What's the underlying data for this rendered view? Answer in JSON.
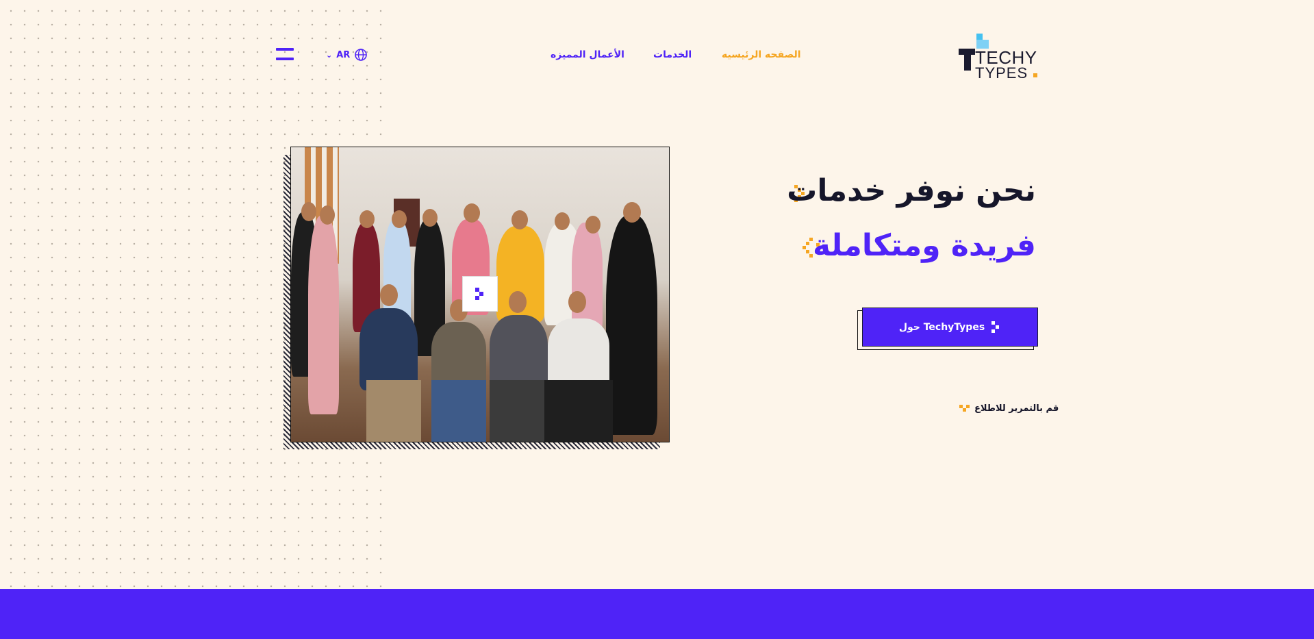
{
  "header": {
    "logo": {
      "line1": "TECHY",
      "line2": "TYPES"
    },
    "nav": [
      {
        "label": "الصفحه الرئيسيه",
        "active": true
      },
      {
        "label": "الخدمات",
        "active": false
      },
      {
        "label": "الأعمال المميزه",
        "active": false
      }
    ],
    "language": {
      "label": "AR",
      "icon": "globe-icon"
    },
    "menu_icon": "hamburger-menu-icon"
  },
  "hero": {
    "headline_line1": "نحن نوفر خدمات",
    "headline_line2": "فريدة ومتكاملة",
    "cta_label": "حول TechyTypes",
    "scroll_hint": "قم بالتمرير للاطلاع",
    "photo": {
      "description_icon": "team-photo"
    }
  },
  "colors": {
    "primary": "#4f23f7",
    "accent": "#f5a623",
    "background": "#fdf5ea",
    "dark": "#16162a"
  }
}
